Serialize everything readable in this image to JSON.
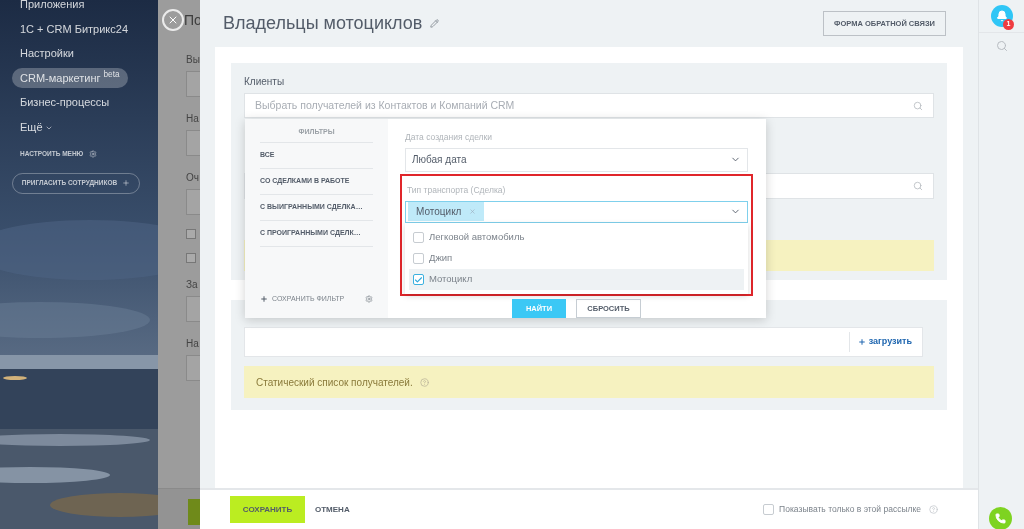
{
  "sidebar": {
    "items": [
      {
        "label": "Приложения",
        "selected": false
      },
      {
        "label": "1С + CRM Битрикс24",
        "selected": false
      },
      {
        "label": "Настройки",
        "selected": false
      },
      {
        "label": "CRM-маркетинг $^{beta}$",
        "selected": true
      },
      {
        "label": "Бизнес-процессы",
        "selected": false
      },
      {
        "label": "Ещё",
        "selected": false
      }
    ],
    "settings_link": "НАСТРОИТЬ МЕНЮ",
    "invite_button": "ПРИГЛАСИТЬ СОТРУДНИКОВ"
  },
  "background_page": {
    "title": "По",
    "fields": [
      {
        "kind": "field",
        "label": "Вы"
      },
      {
        "kind": "field",
        "label": "На"
      },
      {
        "kind": "field",
        "label": "Оч"
      },
      {
        "kind": "checkbox",
        "checked": false
      },
      {
        "kind": "checkbox",
        "checked": false
      },
      {
        "kind": "field",
        "label": "За"
      },
      {
        "kind": "field",
        "label": "На"
      }
    ]
  },
  "slider": {
    "title": "Владельцы мотоциклов",
    "feedback_button": "ФОРМА ОБРАТНОЙ СВЯЗИ",
    "clients": {
      "label": "Клиенты",
      "placeholder": "Выбрать получателей из Контактов и Компаний CRM"
    },
    "filter_popup": {
      "header": "ФИЛЬТРЫ",
      "presets": [
        "ВСЕ",
        "СО СДЕЛКАМИ В РАБОТЕ",
        "С ВЫИГРАННЫМИ СДЕЛКА…",
        "С ПРОИГРАННЫМИ СДЕЛК…"
      ],
      "save_filter": "СОХРАНИТЬ ФИЛЬТР",
      "date_field": {
        "label": "Дата создания сделки",
        "value": "Любая дата"
      },
      "transport_field": {
        "label": "Тип транспорта (Сделка)",
        "tags": [
          "Мотоцикл"
        ],
        "options": [
          {
            "label": "Легковой автомобиль",
            "checked": false,
            "highlighted": false
          },
          {
            "label": "Джип",
            "checked": false,
            "highlighted": false
          },
          {
            "label": "Мотоцикл",
            "checked": true,
            "highlighted": true
          }
        ]
      },
      "find_button": "НАЙТИ",
      "reset_button": "СБРОСИТЬ"
    },
    "upload_link": "загрузить",
    "notice": "Статический список получателей.",
    "footer": {
      "save_button": "СОХРАНИТЬ",
      "cancel_button": "ОТМЕНА",
      "only_this": {
        "label": "Показывать только в этой рассылке",
        "checked": false
      }
    }
  },
  "right_bar": {
    "notification_count": "1"
  }
}
